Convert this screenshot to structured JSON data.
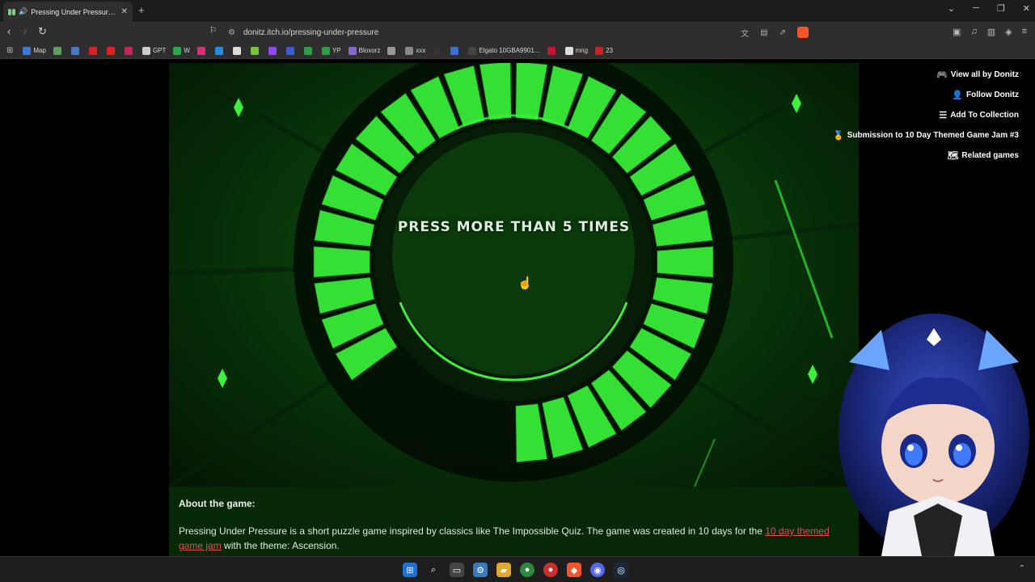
{
  "browser": {
    "tab_title": "Pressing Under Pressure by Donitz",
    "address": "donitz.itch.io/pressing-under-pressure",
    "bookmarks": [
      {
        "label": "Map",
        "color": "#3a7bd5"
      },
      {
        "label": "",
        "color": "#5a9f5a"
      },
      {
        "label": "",
        "color": "#4a78c8"
      },
      {
        "label": "",
        "color": "#e02020"
      },
      {
        "label": "",
        "color": "#e02020"
      },
      {
        "label": "",
        "color": "#cc2255"
      },
      {
        "label": "GPT",
        "color": "#cccccc"
      },
      {
        "label": "W",
        "color": "#2aa84a"
      },
      {
        "label": "",
        "color": "#d6307a"
      },
      {
        "label": "",
        "color": "#1d8fe0"
      },
      {
        "label": "",
        "color": "#dddddd"
      },
      {
        "label": "",
        "color": "#7ac142"
      },
      {
        "label": "",
        "color": "#9146ff"
      },
      {
        "label": "",
        "color": "#3b5bdb"
      },
      {
        "label": "",
        "color": "#2e9e44"
      },
      {
        "label": "YP",
        "color": "#2e9e44"
      },
      {
        "label": "Bloxorz",
        "color": "#8866cc"
      },
      {
        "label": "",
        "color": "#999999"
      },
      {
        "label": "xxx",
        "color": "#888888"
      },
      {
        "label": "",
        "color": "#333333"
      },
      {
        "label": "",
        "color": "#3a6fd8"
      },
      {
        "label": "Elgato 10GBA9901...",
        "color": "#444444"
      },
      {
        "label": "",
        "color": "#cc1133"
      },
      {
        "label": "mng",
        "color": "#dddddd"
      },
      {
        "label": "23",
        "color": "#cc2222"
      }
    ]
  },
  "game": {
    "prompt": "PRESS MORE THAN 5 TIMES",
    "accent": "#35e035",
    "progress_segments_filled": 29,
    "progress_segments_total": 29
  },
  "sidebar": {
    "links": [
      {
        "label": "View all by Donitz",
        "icon": "gamepad-icon"
      },
      {
        "label": "Follow Donitz",
        "icon": "user-plus-icon"
      },
      {
        "label": "Add To Collection",
        "icon": "list-add-icon"
      },
      {
        "label": "Submission to 10 Day Themed Game Jam #3",
        "icon": "award-icon"
      },
      {
        "label": "Related games",
        "icon": "map-icon"
      }
    ]
  },
  "description": {
    "heading": "About the game:",
    "text_before": "Pressing Under Pressure is a short puzzle game inspired by classics like The Impossible Quiz. The game was created in 10 days for the ",
    "link_text": "10 day themed game jam",
    "text_after": " with the theme: Ascension."
  }
}
